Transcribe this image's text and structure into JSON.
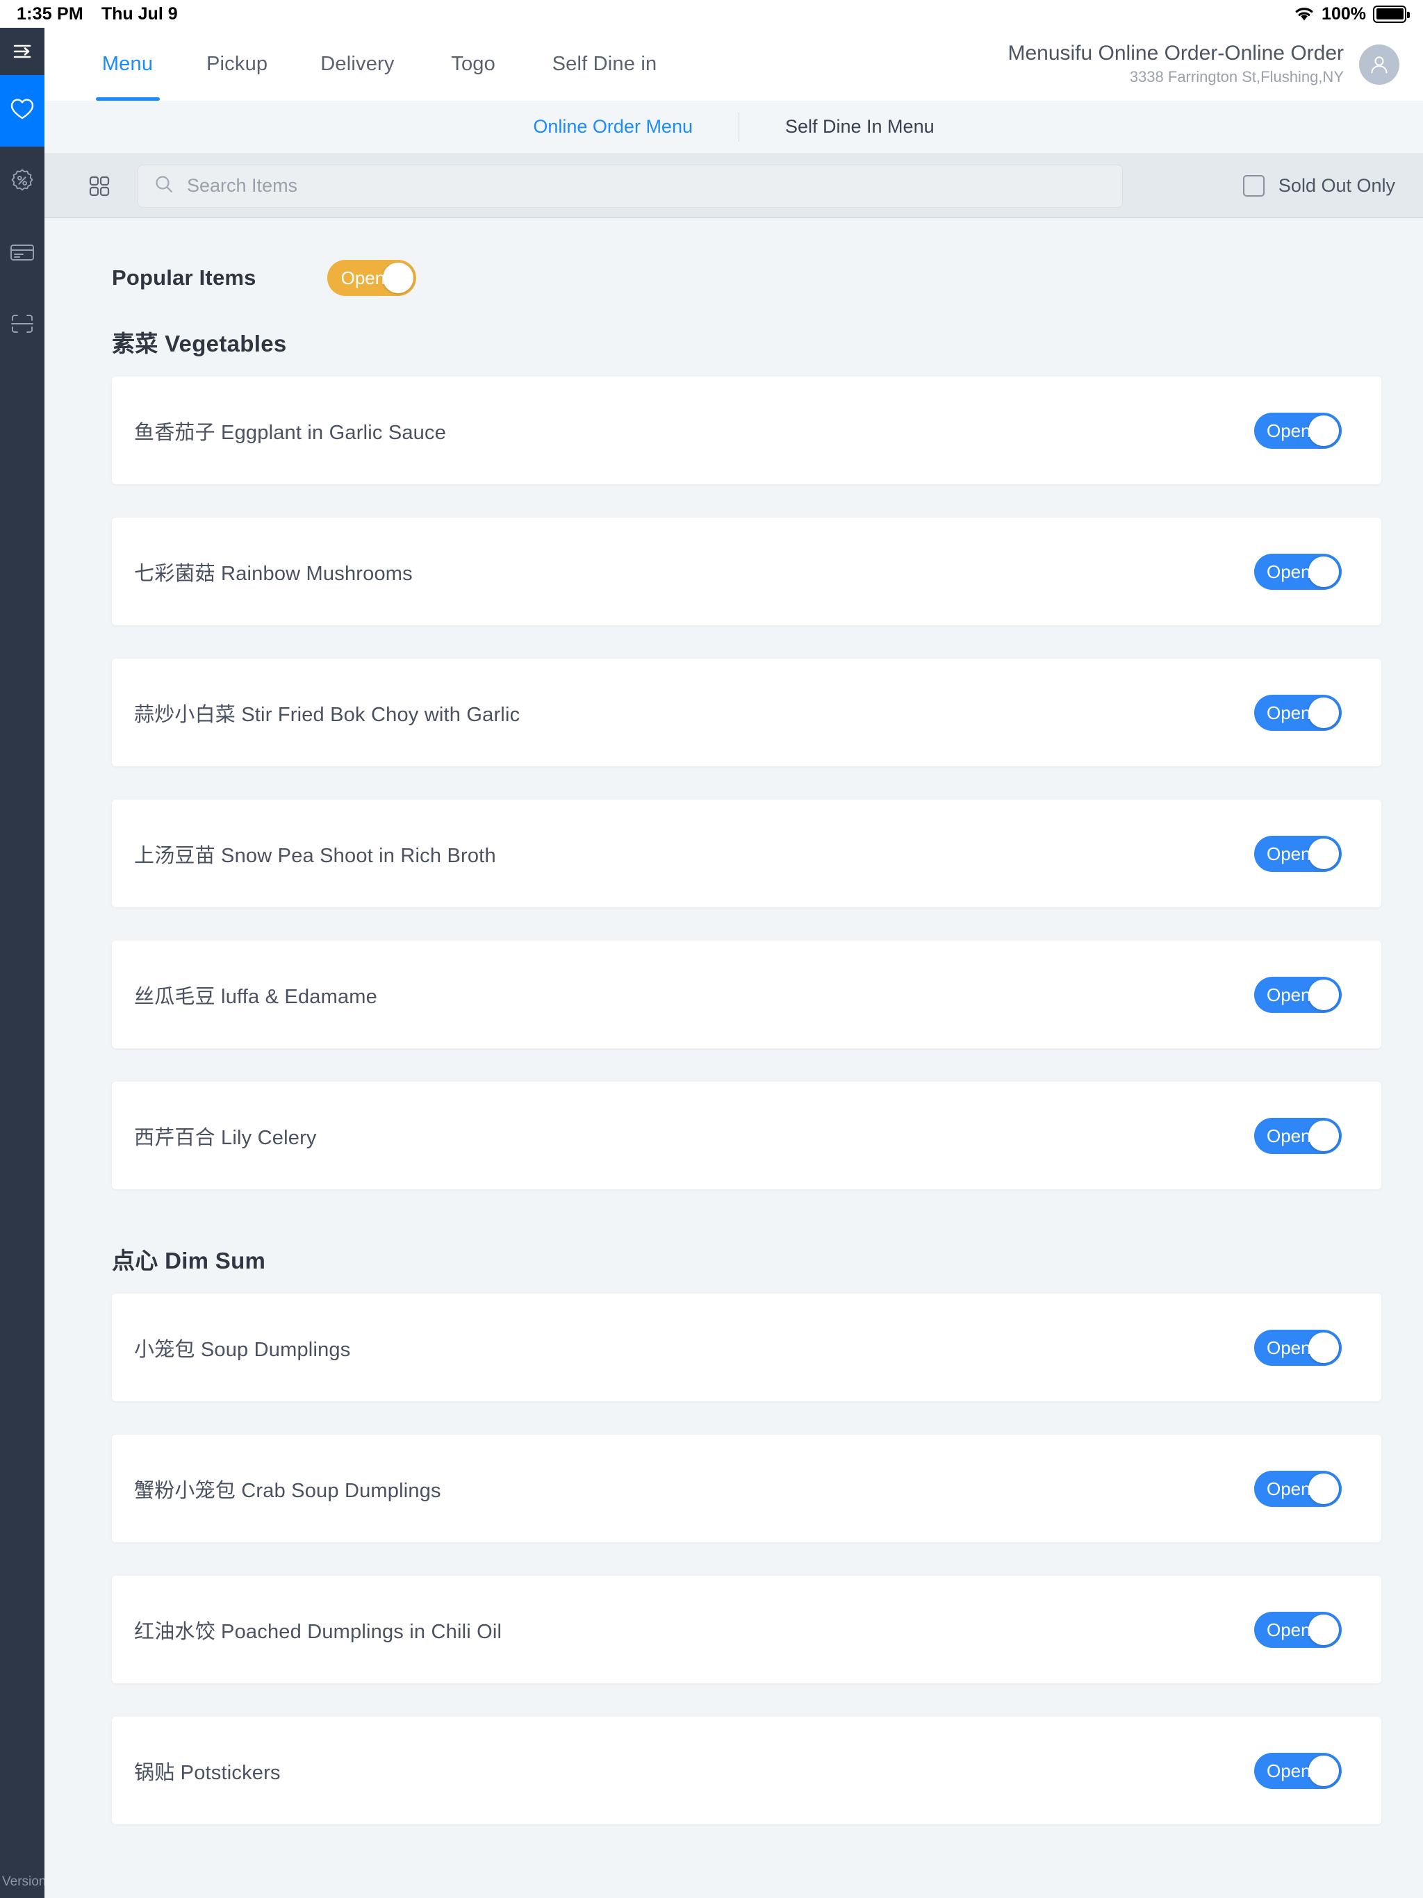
{
  "statusbar": {
    "time": "1:35 PM",
    "date": "Thu Jul 9",
    "battery_percent": "100%",
    "wifi_icon": "wifi-icon",
    "battery_icon": "battery-full-icon"
  },
  "sidebar": {
    "toggle_icon": "sidebar-collapse-icon",
    "version_label": "Version",
    "items": [
      {
        "icon": "heart-icon",
        "active": true
      },
      {
        "icon": "discount-badge-icon",
        "active": false
      },
      {
        "icon": "card-icon",
        "active": false
      },
      {
        "icon": "scan-icon",
        "active": false
      }
    ]
  },
  "topnav": {
    "tabs": [
      {
        "label": "Menu",
        "active": true
      },
      {
        "label": "Pickup",
        "active": false
      },
      {
        "label": "Delivery",
        "active": false
      },
      {
        "label": "Togo",
        "active": false
      },
      {
        "label": "Self Dine in",
        "active": false
      }
    ],
    "brand_title": "Menusifu Online Order-Online Order",
    "brand_address": "3338 Farrington St,Flushing,NY",
    "avatar_icon": "user-avatar-icon"
  },
  "submenu": {
    "links": [
      {
        "label": "Online Order Menu",
        "active": true
      },
      {
        "label": "Self Dine In Menu",
        "active": false
      }
    ]
  },
  "search": {
    "grid_icon": "grid-view-icon",
    "search_icon": "search-icon",
    "placeholder": "Search Items",
    "value": "",
    "sold_out_label": "Sold Out Only",
    "sold_out_checked": false
  },
  "colors": {
    "accent_blue": "#1a8cff",
    "toggle_blue": "#2f86f6",
    "toggle_orange": "#efb13e",
    "sidebar_dark": "#2d3748",
    "page_bg": "#f1f5f8"
  },
  "popular": {
    "label": "Popular Items",
    "toggle_label": "Open",
    "toggle_on": true
  },
  "sections": [
    {
      "title": "素菜 Vegetables",
      "items": [
        {
          "name": "鱼香茄子 Eggplant in Garlic Sauce",
          "toggle_label": "Open",
          "toggle_on": true
        },
        {
          "name": "七彩菌菇 Rainbow Mushrooms",
          "toggle_label": "Open",
          "toggle_on": true
        },
        {
          "name": "蒜炒小白菜 Stir Fried Bok Choy with Garlic",
          "toggle_label": "Open",
          "toggle_on": true
        },
        {
          "name": "上汤豆苗 Snow Pea Shoot in Rich Broth",
          "toggle_label": "Open",
          "toggle_on": true
        },
        {
          "name": "丝瓜毛豆 luffa & Edamame",
          "toggle_label": "Open",
          "toggle_on": true
        },
        {
          "name": "西芹百合 Lily Celery",
          "toggle_label": "Open",
          "toggle_on": true
        }
      ]
    },
    {
      "title": "点心 Dim Sum",
      "items": [
        {
          "name": "小笼包 Soup Dumplings",
          "toggle_label": "Open",
          "toggle_on": true
        },
        {
          "name": "蟹粉小笼包 Crab Soup Dumplings",
          "toggle_label": "Open",
          "toggle_on": true
        },
        {
          "name": "红油水饺 Poached Dumplings in Chili Oil",
          "toggle_label": "Open",
          "toggle_on": true
        },
        {
          "name": "锅贴 Potstickers",
          "toggle_label": "Open",
          "toggle_on": true
        }
      ]
    }
  ]
}
